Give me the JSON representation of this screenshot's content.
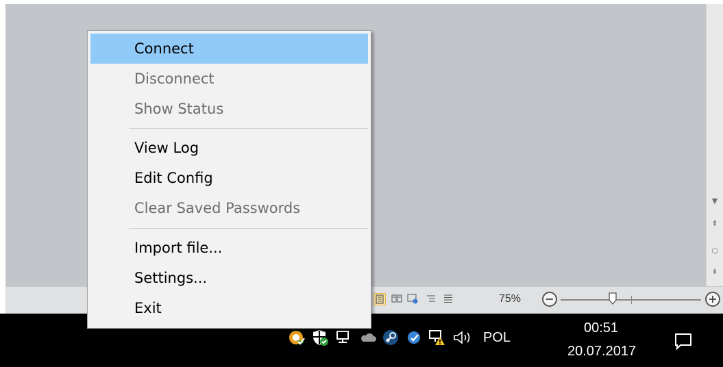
{
  "context_menu": {
    "items": [
      {
        "label": "Connect",
        "enabled": true,
        "highlighted": true
      },
      {
        "label": "Disconnect",
        "enabled": false
      },
      {
        "label": "Show Status",
        "enabled": false
      },
      {
        "label": "View Log",
        "enabled": true
      },
      {
        "label": "Edit Config",
        "enabled": true
      },
      {
        "label": "Clear Saved Passwords",
        "enabled": false
      },
      {
        "label": "Import file...",
        "enabled": true
      },
      {
        "label": "Settings...",
        "enabled": true
      },
      {
        "label": "Exit",
        "enabled": true
      }
    ]
  },
  "status_bar": {
    "zoom_percent": "75%",
    "zoom_out_symbol": "−",
    "zoom_in_symbol": "+",
    "view_buttons": [
      "print-layout-icon",
      "read-mode-icon",
      "web-layout-icon",
      "outline-icon",
      "draft-icon"
    ]
  },
  "scrollbar": {
    "down_arrow": "▼",
    "prev_page": "⇞",
    "browse_object": "○",
    "next_page": "⇟"
  },
  "taskbar": {
    "tray_icons": [
      "openvpn-icon",
      "security-shield-icon",
      "network-icon",
      "onedrive-cloud-icon",
      "steam-icon",
      "network-warning-icon",
      "volume-icon"
    ],
    "volume_glyph": "🕪",
    "language": "POL",
    "time": "00:51",
    "date": "20.07.2017"
  },
  "colors": {
    "highlight": "#91c9f7",
    "menu_bg": "#f2f2f2",
    "disabled_text": "#6d6d6d",
    "taskbar_bg": "#000000"
  }
}
